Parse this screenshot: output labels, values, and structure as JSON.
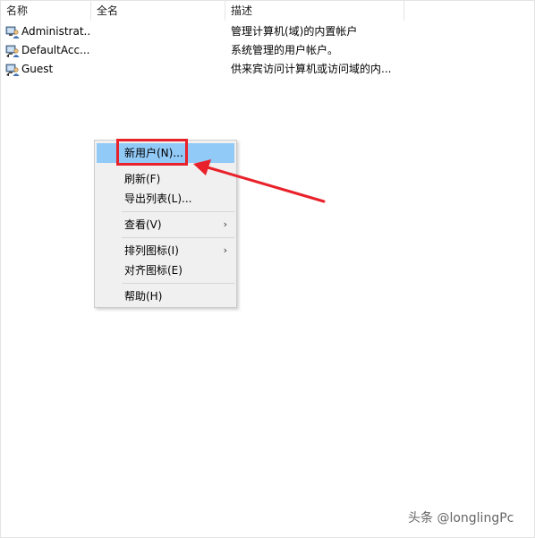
{
  "columns": {
    "name": "名称",
    "fullname": "全名",
    "description": "描述"
  },
  "rows": [
    {
      "name": "Administrat...",
      "fullname": "",
      "description": "管理计算机(域)的内置帐户",
      "icon": "user-account-icon"
    },
    {
      "name": "DefaultAcc...",
      "fullname": "",
      "description": "系统管理的用户帐户。",
      "icon": "user-account-icon"
    },
    {
      "name": "Guest",
      "fullname": "",
      "description": "供来宾访问计算机或访问域的内...",
      "icon": "user-account-icon"
    }
  ],
  "menu": {
    "new_user": "新用户(N)...",
    "refresh": "刷新(F)",
    "export_list": "导出列表(L)...",
    "view": "查看(V)",
    "arrange_icons": "排列图标(I)",
    "align_icons": "对齐图标(E)",
    "help": "帮助(H)"
  },
  "annotation": {
    "highlight_color": "#e8212a"
  },
  "watermark": "头条 @longlingPc"
}
